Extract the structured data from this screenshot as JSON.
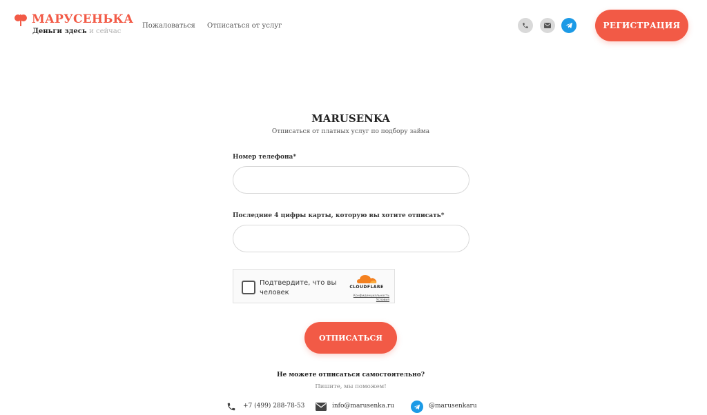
{
  "header": {
    "logo_title": "МАРУСЕНЬКА",
    "logo_sub_bold": "Деньги здесь",
    "logo_sub_light": "и сейчас",
    "nav": [
      "Пожаловаться",
      "Отписаться от услуг"
    ],
    "icons": [
      "phone-icon",
      "mail-icon",
      "telegram-icon"
    ],
    "register_label": "РЕГИСТРАЦИЯ"
  },
  "form": {
    "title": "MARUSENKA",
    "subtitle": "Отписаться от платных услуг по подбору займа",
    "phone_label": "Номер телефона*",
    "phone_value": "",
    "card_label": "Последние 4 цифры карты, которую вы хотите отписать*",
    "card_value": "",
    "captcha": {
      "text": "Подтвердите, что вы человек",
      "brand": "CLOUDFLARE",
      "privacy": "Конфиденциальность",
      "terms": "Условия"
    },
    "submit_label": "ОТПИСАТЬСЯ"
  },
  "help": {
    "question": "Не можете отписаться самостоятельно?",
    "answer": "Пишите, мы поможем!"
  },
  "contacts": {
    "phone": "+7 (499) 288-78-53",
    "email": "info@marusenka.ru",
    "telegram": "@marusenkaru"
  },
  "colors": {
    "accent": "#f25a46",
    "telegram": "#1c9ae6",
    "icon_bg": "#d9d9d9"
  }
}
